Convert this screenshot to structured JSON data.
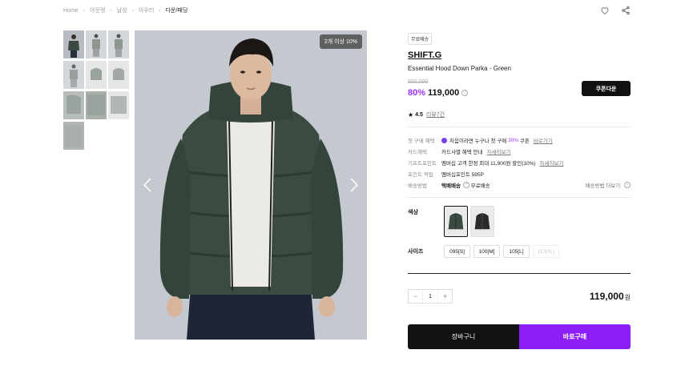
{
  "breadcrumb": [
    "Home",
    "아웃렛",
    "남성",
    "아우터",
    "다운/패딩"
  ],
  "main_image": {
    "badge": "2개 이상 10%"
  },
  "product": {
    "shipping_tag": "무료배송",
    "brand": "SHIFT.G",
    "name": "Essential Hood Down Parka - Green",
    "original_price": "500,000",
    "discount": "80%",
    "price": "119,000",
    "coupon_button": "쿠폰다운",
    "rating": "4.5",
    "reviews": "리뷰7건"
  },
  "benefits": {
    "first_label": "첫 구매 혜택",
    "first_text_a": "처음이라면 누구나 첫 구매",
    "first_text_pct": "30%",
    "first_text_b": "쿠폰",
    "first_link": "바로가기",
    "card_label": "카드혜택",
    "card_text": "카드사별 혜택 안내",
    "card_link": "자세히보기",
    "gift_label": "기프트포인트",
    "gift_text": "멤버십 고객 한정 최대 11,900원 할인(10%)",
    "gift_link": "자세히보기",
    "point_label": "포인트 적립",
    "point_text": "멤버십포인트 595P",
    "delivery_label": "배송방법",
    "delivery_method": "택배배송",
    "delivery_free": "무료배송",
    "delivery_more": "배송방법 더보기"
  },
  "options": {
    "color_label": "색상",
    "size_label": "사이즈",
    "sizes": [
      "095[S]",
      "100[M]",
      "105[L]",
      "110[XL]"
    ]
  },
  "order": {
    "qty": "1",
    "minus": "−",
    "plus": "+",
    "total": "119,000",
    "won": "원",
    "cart_button": "장바구니",
    "buy_button": "바로구매"
  },
  "colors": {
    "accent": "#9b30ff",
    "buy": "#8b1ef5",
    "jacket": "#3a4a40"
  }
}
